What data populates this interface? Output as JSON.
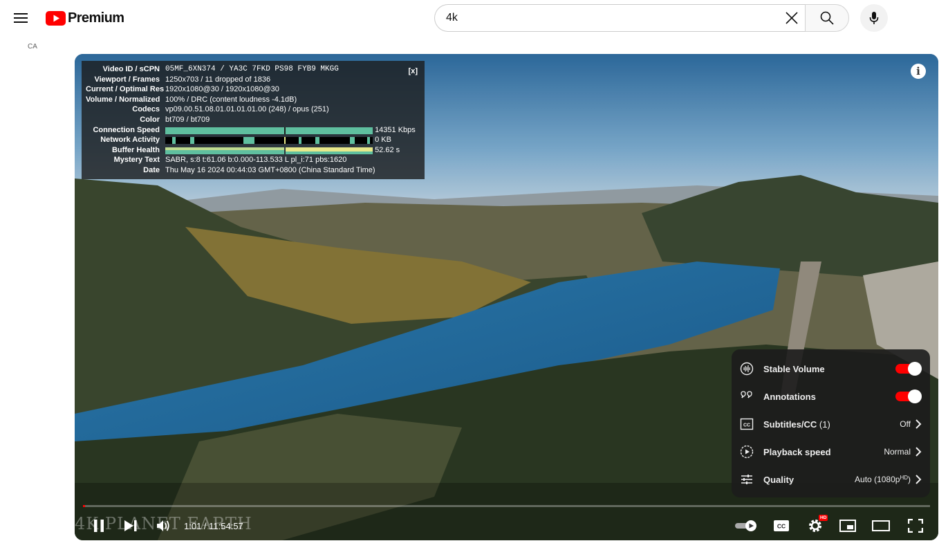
{
  "masthead": {
    "logo_text": "Premium",
    "country_code": "CA",
    "search": {
      "value": "4k"
    }
  },
  "stats": {
    "close_label": "[x]",
    "rows": [
      {
        "key": "Video ID / sCPN",
        "value": "05MF_6XN374 / YA3C 7FKD PS98 FYB9 MKGG"
      },
      {
        "key": "Viewport / Frames",
        "value": "1250x703 / 11 dropped of 1836"
      },
      {
        "key": "Current / Optimal Res",
        "value": "1920x1080@30 / 1920x1080@30"
      },
      {
        "key": "Volume / Normalized",
        "value": "100% / DRC (content loudness -4.1dB)"
      },
      {
        "key": "Codecs",
        "value": "vp09.00.51.08.01.01.01.01.00 (248) / opus (251)"
      },
      {
        "key": "Color",
        "value": "bt709 / bt709"
      },
      {
        "key": "Connection Speed",
        "value": "14351 Kbps"
      },
      {
        "key": "Network Activity",
        "value": "0 KB"
      },
      {
        "key": "Buffer Health",
        "value": "52.62 s"
      },
      {
        "key": "Mystery Text",
        "value": "SABR, s:8 t:61.06 b:0.000-113.533 L pl_i:71 pbs:1620"
      },
      {
        "key": "Date",
        "value": "Thu May 16 2024 00:44:03 GMT+0800 (China Standard Time)"
      }
    ],
    "colors": {
      "graph_teal": "#5fbf9f",
      "graph_yellow": "#e8e88a",
      "graph_black": "#000000"
    }
  },
  "settings_menu": {
    "items": [
      {
        "label": "Stable Volume",
        "icon": "stable-volume-icon",
        "toggle": true
      },
      {
        "label": "Annotations",
        "icon": "annotations-icon",
        "toggle": true
      },
      {
        "label": "Subtitles/CC",
        "count": "(1)",
        "value": "Off",
        "icon": "subtitles-icon"
      },
      {
        "label": "Playback speed",
        "value": "Normal",
        "icon": "playback-speed-icon"
      },
      {
        "label": "Quality",
        "value": "Auto (1080p",
        "value_sup": "HD",
        "value_close": ")",
        "icon": "quality-icon"
      }
    ]
  },
  "player": {
    "current_time": "1:01",
    "duration": "11:54:57",
    "time_display": "1:01 / 11:54:57",
    "progress_fraction": 0.0014,
    "watermark": "4K PLANET EARTH",
    "hd_badge": "HD",
    "accent_color": "#ff0000"
  }
}
